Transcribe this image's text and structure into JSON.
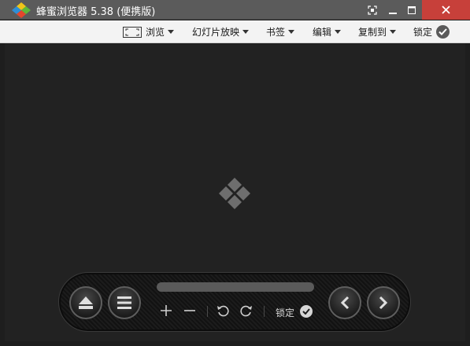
{
  "window": {
    "title": "蜂蜜浏览器 5.38 (便携版)"
  },
  "menubar": {
    "items": [
      {
        "label": "浏览"
      },
      {
        "label": "幻灯片放映"
      },
      {
        "label": "书签"
      },
      {
        "label": "编辑"
      },
      {
        "label": "复制到"
      },
      {
        "label": "锁定"
      }
    ]
  },
  "toolbar": {
    "lock_label": "锁定",
    "progress": 0
  },
  "colors": {
    "titlebar": "#5b5b5b",
    "close_button": "#c7403a",
    "menubar": "#f3f3f3",
    "viewer_bg": "#222222",
    "logo_blue": "#2f8fd6",
    "logo_green": "#5fb83a",
    "logo_yellow": "#f0c419",
    "logo_red": "#e5462d"
  },
  "icons": {
    "app": "honeyview-logo-icon",
    "center": "honeyview-placeholder-icon"
  }
}
